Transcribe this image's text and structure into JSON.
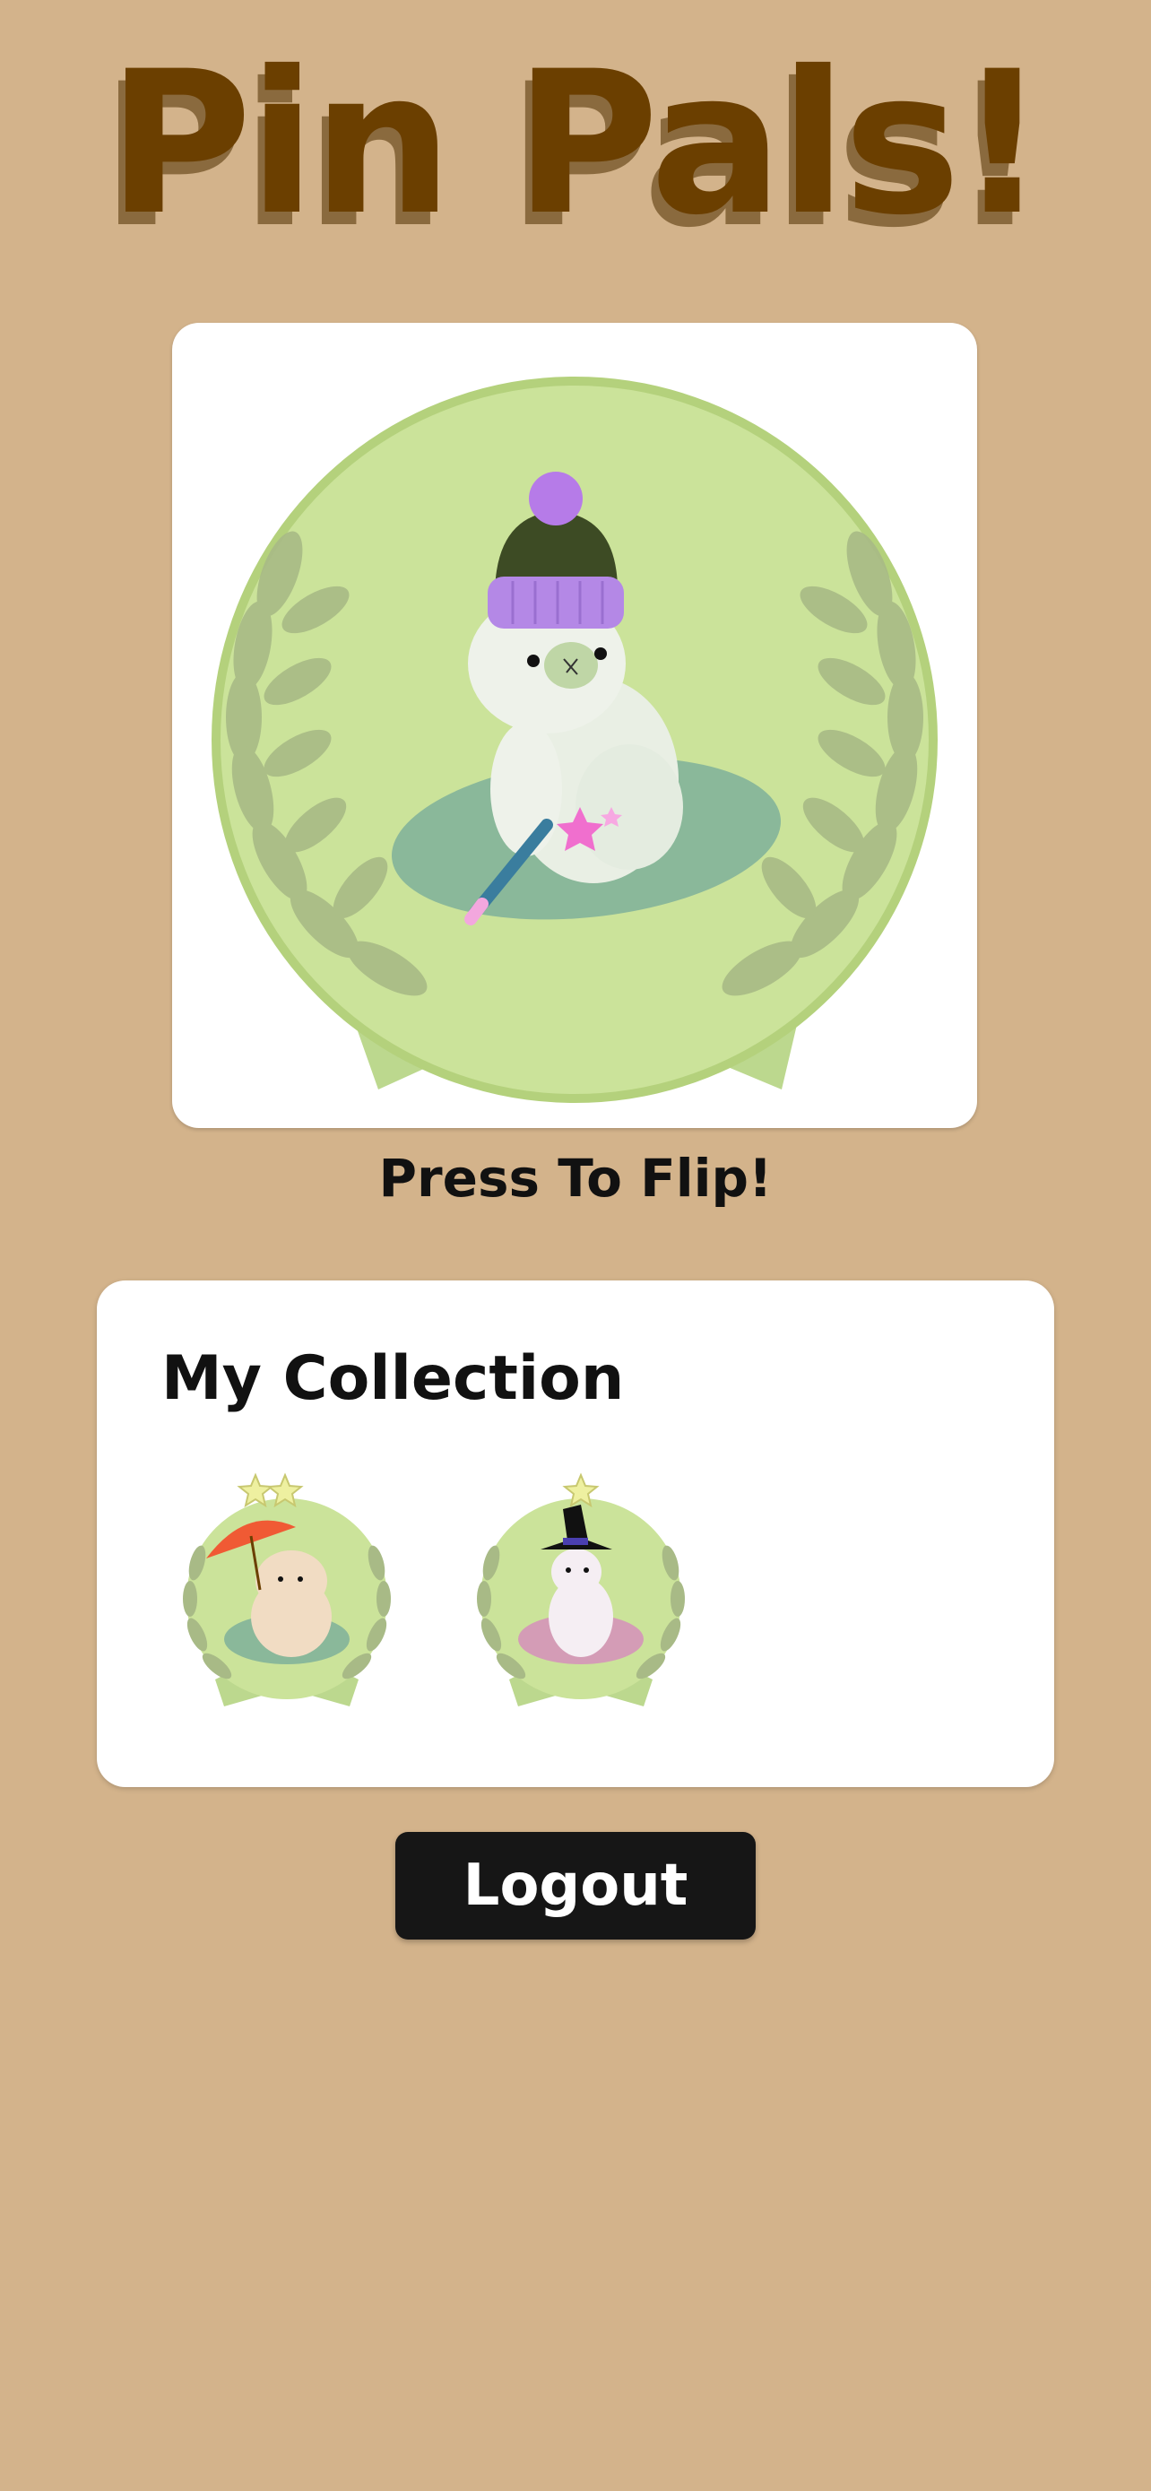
{
  "app": {
    "title": "Pin Pals!"
  },
  "flip_card": {
    "label": "Press To Flip!"
  },
  "collection": {
    "heading": "My Collection",
    "pins": [
      {
        "name": "bear-umbrella-pin",
        "stars": 2
      },
      {
        "name": "alpaca-witch-pin",
        "stars": 1
      }
    ]
  },
  "logout": {
    "label": "Logout"
  },
  "colors": {
    "background": "#d3b38b",
    "title": "#6b3f00",
    "badge_green": "#cbe39a",
    "laurel": "#a8ba86",
    "button": "#161616"
  }
}
